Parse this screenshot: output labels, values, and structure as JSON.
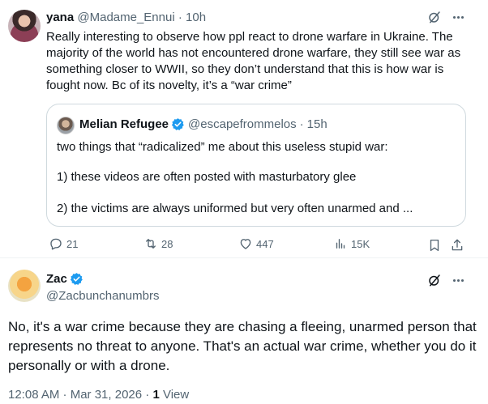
{
  "post1": {
    "author_name": "yana",
    "handle": "@Madame_Ennui",
    "separator": "·",
    "time": "10h",
    "text": "Really interesting to observe how ppl react to drone warfare in Ukraine. The majority of the world has not encountered drone warfare, they still see war as something closer to WWII, so they don’t understand that this is how war is fought now. Bc of its novelty, it’s a “war crime”",
    "quote": {
      "author_name": "Melian Refugee",
      "handle": "@escapefrommelos",
      "separator": "·",
      "time": "15h",
      "lines": [
        "two things that “radicalized” me about this useless stupid war:",
        "1) these videos are often posted with masturbatory glee",
        "2) the victims are always uniformed but very often unarmed and ..."
      ]
    },
    "actions": {
      "replies": "21",
      "reposts": "28",
      "likes": "447",
      "views": "15K"
    }
  },
  "post2": {
    "author_name": "Zac",
    "handle": "@Zacbunchanumbrs",
    "text": "No, it's a war crime because they are chasing a fleeing, unarmed person that represents no threat to anyone. That's an actual war crime, whether you do it personally or with a drone.",
    "timestamp": "12:08 AM · Mar 31, 2026",
    "separator": "·",
    "views_count": "1",
    "views_label": "View"
  },
  "colors": {
    "verified": "#1d9bf0",
    "secondary_text": "#536471",
    "border": "#cfd9de"
  }
}
